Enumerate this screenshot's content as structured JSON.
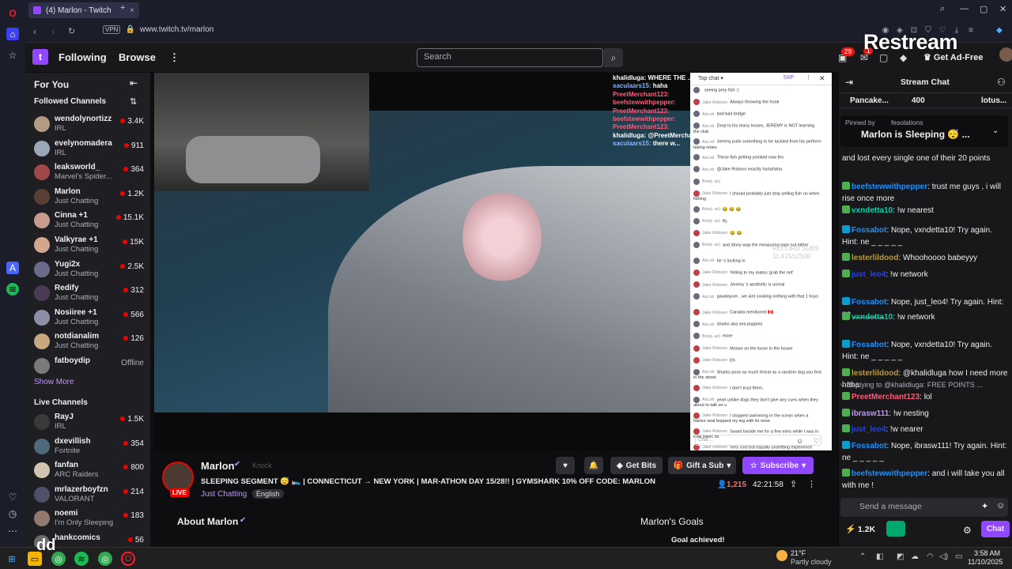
{
  "browser": {
    "tab_title": "(4) Marlon - Twitch",
    "tab_close": "×",
    "new_tab": "+",
    "vpn": "VPN",
    "url": "www.twitch.tv/marlon"
  },
  "twitch": {
    "nav_following": "Following",
    "nav_browse": "Browse",
    "nav_more": "⋮",
    "search_placeholder": "Search",
    "notif_count": "29",
    "inbox_count": "1",
    "ad_free": "Get Ad-Free",
    "restream_watermark": "Restream"
  },
  "sidebar": {
    "for_you": "For You",
    "followed_header": "Followed Channels",
    "followed": [
      {
        "name": "wendolynortizz",
        "game": "IRL",
        "viewers": "3.4K",
        "color": "#b39a82"
      },
      {
        "name": "evelynomadera",
        "game": "IRL",
        "viewers": "911",
        "color": "#9aa7b8"
      },
      {
        "name": "leaksworld_",
        "game": "Marvel's Spider...",
        "viewers": "364",
        "color": "#a0484a"
      },
      {
        "name": "Marlon",
        "game": "Just Chatting",
        "viewers": "1.2K",
        "color": "#5a4034"
      },
      {
        "name": "Cinna +1",
        "game": "Just Chatting",
        "viewers": "15.1K",
        "color": "#c79b8f"
      },
      {
        "name": "Valkyrae +1",
        "game": "Just Chatting",
        "viewers": "15K",
        "color": "#d4a58f"
      },
      {
        "name": "Yugi2x",
        "game": "Just Chatting",
        "viewers": "2.5K",
        "color": "#6b6b8a"
      },
      {
        "name": "Redify",
        "game": "Just Chatting",
        "viewers": "312",
        "color": "#4b3b55"
      },
      {
        "name": "Nosiiree +1",
        "game": "Just Chatting",
        "viewers": "566",
        "color": "#8c8fa6"
      },
      {
        "name": "notdianalim",
        "game": "Just Chatting",
        "viewers": "126",
        "color": "#c9a77f"
      },
      {
        "name": "fatboydip",
        "game": "",
        "viewers": "Offline",
        "color": "#7a7a7a"
      }
    ],
    "show_more": "Show More",
    "live_header": "Live Channels",
    "live": [
      {
        "name": "RayJ",
        "game": "IRL",
        "viewers": "1.5K",
        "color": "#3a3a3a"
      },
      {
        "name": "dxevillish",
        "game": "Fortnite",
        "viewers": "354",
        "color": "#4d6b7c"
      },
      {
        "name": "fanfan",
        "game": "ARC Raiders",
        "viewers": "800",
        "color": "#d3c4b2"
      },
      {
        "name": "mrlazerboyfzn",
        "game": "VALORANT",
        "viewers": "214",
        "color": "#50506a"
      },
      {
        "name": "noemi",
        "game": "I'm Only Sleeping",
        "viewers": "183",
        "color": "#927a6e"
      },
      {
        "name": "hankcomics",
        "game": "",
        "viewers": "56",
        "color": "#6c6c6c"
      }
    ]
  },
  "video_overlay_chat": [
    {
      "user": "khalidluga:",
      "text": " WHERE THE ...",
      "color": "#ffffff"
    },
    {
      "user": "saculaars15:",
      "text": " haha",
      "color": "#8ab4ff"
    },
    {
      "user": "PreetMerchant123:",
      "text": "",
      "color": "#ff5a7a"
    },
    {
      "user": "beefstewwithpepper:",
      "text": "",
      "color": "#ff5a7a"
    },
    {
      "user": "PreetMerchant123:",
      "text": "",
      "color": "#ff5a7a"
    },
    {
      "user": "beefstewwithpepper:",
      "text": "",
      "color": "#ff5a7a"
    },
    {
      "user": "PreetMerchant123:",
      "text": "",
      "color": "#ff5a7a"
    },
    {
      "user": "khalidluga:",
      "text": " @PreetMerchant...",
      "color": "#ffffff"
    },
    {
      "user": "saculaars15:",
      "text": " there w...",
      "color": "#8ab4ff"
    }
  ],
  "popup_chat": {
    "title": "Top chat",
    "xp": "5XP",
    "messages": [
      {
        "name": "",
        "text": "seeing prey fish :)"
      },
      {
        "name": "Jake Robson",
        "text": "Always throwing the hook"
      },
      {
        "name": "AxLnlr",
        "text": "bad bait bridge"
      },
      {
        "name": "AxLnlr",
        "text": "Drop to his many losses, JEREMY is NOT learning the club"
      },
      {
        "name": "AxLnlr",
        "text": "Jeremy pulls something to be tackled from his perform taking notes"
      },
      {
        "name": "AxLnlr",
        "text": "These fish getting yoinked now tho"
      },
      {
        "name": "AxLnlr",
        "text": "@Jake Robson exactly hahahaha"
      },
      {
        "name": "Bnis(--ar)",
        "text": ""
      },
      {
        "name": "Jake Robson",
        "text": "I should probably just stop yelling fish on when fishing"
      },
      {
        "name": "Bnis(--ar)",
        "text": "😂 😂 😂"
      },
      {
        "name": "Bnis(--ar)",
        "text": "ffs"
      },
      {
        "name": "Jake Robson",
        "text": "😂 😂"
      },
      {
        "name": "Bnis(--ar)",
        "text": "and dinny wap the measuring tape out either"
      },
      {
        "name": "AxLnlr",
        "text": "he 's locking in"
      },
      {
        "name": "Jake Robson",
        "text": "Yelling to my mates 'grab the net'"
      },
      {
        "name": "Jake Robson",
        "text": "Jeremy 's aesthetic is unreal"
      },
      {
        "name": "AxLnlr",
        "text": "gawdayum , we aint cooking nothing with that 1 boys"
      },
      {
        "name": "Jake Robson",
        "text": "Canada mentioned 🇨🇦"
      },
      {
        "name": "AxLnlr",
        "text": "sharks aka sea puppies"
      },
      {
        "name": "Bnis(--ar)",
        "text": "more"
      },
      {
        "name": "Jake Robson",
        "text": "Moose on the loose in the house"
      },
      {
        "name": "Jake Robson",
        "text": "Eh"
      },
      {
        "name": "AxLnlr",
        "text": "Sharks pose as much threat as a random dog you find in the street"
      },
      {
        "name": "Jake Robson",
        "text": "I don't trust them."
      },
      {
        "name": "AxLnlr",
        "text": "yeah unlike dogs they don't give any cues when they about to talk on u"
      },
      {
        "name": "Jake Robson",
        "text": "I stopped swimming in the ocean when a harbor seal bopped my leg with its nose"
      },
      {
        "name": "Jake Robson",
        "text": "Swam beside me for a few mins while I was in total panic lol"
      },
      {
        "name": "Jake Robson",
        "text": "Very cool but equally unsettling experience"
      }
    ],
    "input_placeholder": "Chat ...",
    "record_overlay": "RECORD SUBS",
    "record_count": "11,415/12500"
  },
  "stream": {
    "streamer": "Marlon",
    "extra_tag": "Knock",
    "title": "SLEEPING SEGMENT 😴 🛌 | CONNECTICUT → NEW YORK | MAR-ATHON DAY 15/28!! | GYMSHARK 10% OFF CODE: MARLON",
    "category": "Just Chatting",
    "language": "English",
    "live_label": "LIVE",
    "viewers": "1,215",
    "uptime": "42:21:58",
    "get_bits": "Get Bits",
    "gift_sub": "Gift a Sub",
    "subscribe": "Subscribe",
    "about": "About Marlon",
    "goals": "Marlon's Goals",
    "goal_text": "Goal achieved!"
  },
  "stream_chat": {
    "title": "Stream Chat",
    "hype_left": "Pancake...",
    "hype_count": "400",
    "hype_right": "lotus...",
    "pinned_by": "Pinned by",
    "pinned_user": "fesolations",
    "pinned_text": "Marlon is Sleeping 😴 ...",
    "messages": [
      {
        "user": "",
        "color": "#efeff1",
        "text": "and lost every single one of their 20 points"
      },
      {
        "user": "beefstewwithpepper",
        "color": "#1e90ff",
        "text": ": trust me guys , i will rise once more"
      },
      {
        "user": "vxndetta10",
        "color": "#00d4aa",
        "text": ": !w nearest"
      },
      {
        "user": "Fossabot",
        "color": "#1e90ff",
        "text": ": Nope, vxndetta10! Try again. Hint: ne _ _ _ _ _"
      },
      {
        "user": "lesterlildood",
        "color": "#b99a3e",
        "text": ": Whoohoooo babeyyy"
      },
      {
        "user": "just_leo4",
        "color": "#1e40ff",
        "text": ": !w network"
      },
      {
        "user": "Fossabot",
        "color": "#1e90ff",
        "text": ": Nope, just_leo4! Try again. Hint: ne _ _ _ _ _"
      },
      {
        "user": "vxndetta10",
        "color": "#00d4aa",
        "text": ": !w network"
      },
      {
        "user": "Fossabot",
        "color": "#1e90ff",
        "text": ": Nope, vxndetta10! Try again. Hint: ne _ _ _ _ _"
      },
      {
        "user": "lesterlildood",
        "color": "#b99a3e",
        "text": ": @khalidluga how I need more haha"
      },
      {
        "user": "PreetMerchant123",
        "color": "#ff5a7a",
        "text": ": lol"
      },
      {
        "user": "ibrasw111",
        "color": "#bf94ff",
        "text": ": !w nesting"
      },
      {
        "user": "just_leo4",
        "color": "#1e40ff",
        "text": ": !w nearer"
      },
      {
        "user": "Fossabot",
        "color": "#1e90ff",
        "text": ": Nope, ibrasw111! Try again. Hint: ne _ _ _ _ _"
      },
      {
        "user": "beefstewwithpepper",
        "color": "#1e90ff",
        "text": ": and i will take you all with me !"
      }
    ],
    "reply_text": "Replying to @khalidluga: FREE POINTS ...",
    "send_placeholder": "Send a message",
    "points": "1.2K",
    "chat_button": "Chat"
  },
  "taskbar": {
    "weather_temp": "21°F",
    "weather_desc": "Partly cloudy",
    "time": "3:58 AM",
    "date": "11/10/2025",
    "dd": "dd"
  }
}
